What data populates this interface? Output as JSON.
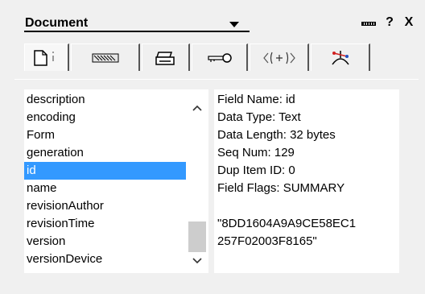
{
  "header": {
    "title": "Document",
    "help_label": "?",
    "close_label": "X",
    "dock_icon": "dock-icon"
  },
  "tabs": [
    {
      "icon": "document-icon",
      "active": true
    },
    {
      "icon": "fields-icon",
      "active": false
    },
    {
      "icon": "printer-icon",
      "active": false
    },
    {
      "icon": "key-icon",
      "active": false
    },
    {
      "icon": "html-tags-icon",
      "active": false
    },
    {
      "icon": "design-icon",
      "active": false
    }
  ],
  "fields_list": {
    "items": [
      "description",
      "encoding",
      "Form",
      "generation",
      "id",
      "name",
      "revisionAuthor",
      "revisionTime",
      "version",
      "versionDevice"
    ],
    "selected": "id",
    "scroll_up_icon": "chevron-up-icon",
    "scroll_down_icon": "chevron-down-icon"
  },
  "field_info": {
    "field_name": "Field Name: id",
    "data_type": "Data Type: Text",
    "data_length": "Data Length: 32 bytes",
    "seq_num": "Seq Num: 129",
    "dup_item_id": "Dup Item ID: 0",
    "field_flags": "Field Flags: SUMMARY",
    "value_line1": "\"8DD1604A9A9CE58EC1",
    "value_line2": "257F02003F8165\""
  },
  "colors": {
    "panel_bg": "#f0f0f0",
    "selection": "#3399ff",
    "scroll_thumb": "#cdcdcd"
  }
}
